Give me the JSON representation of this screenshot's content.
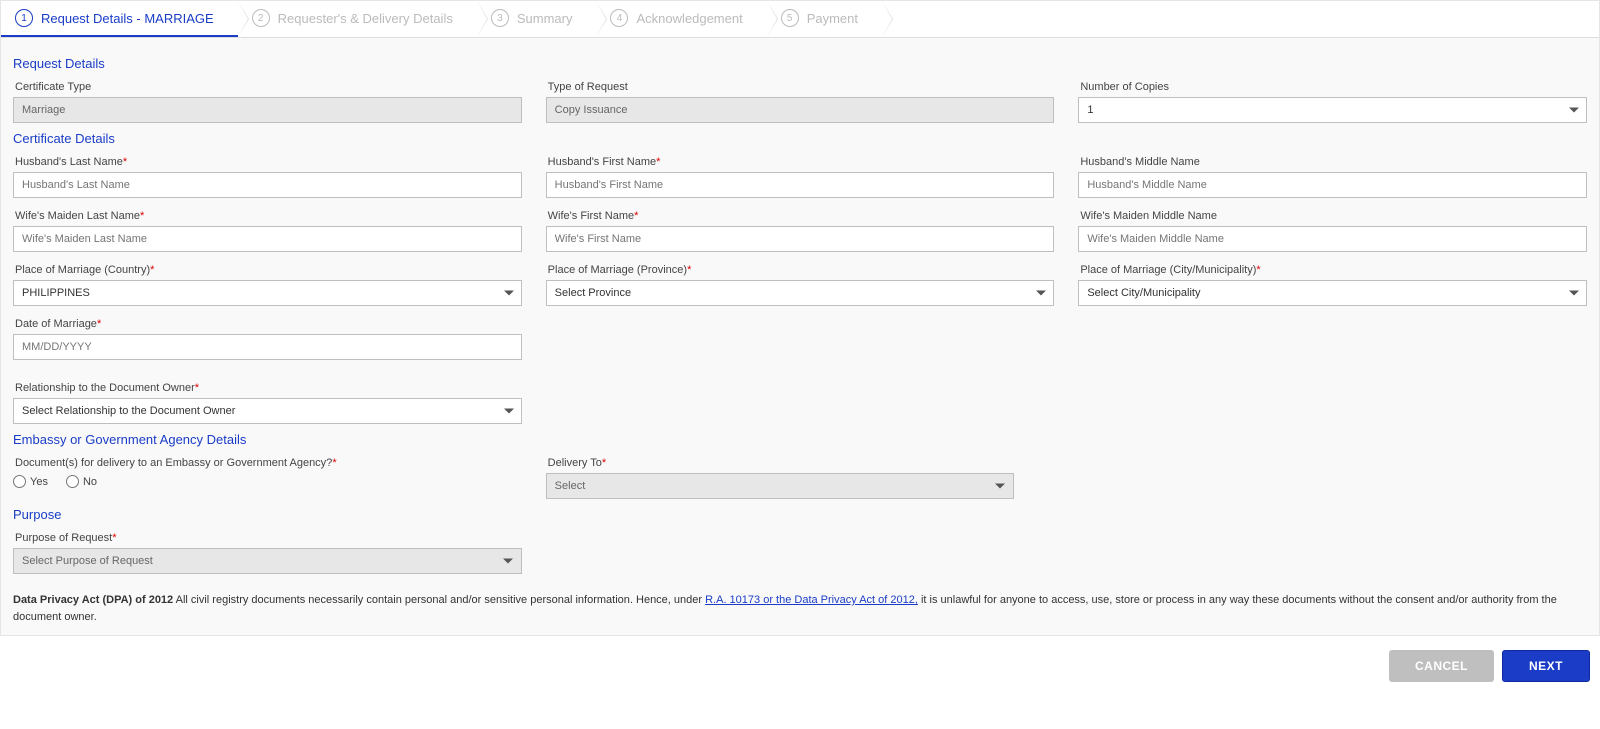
{
  "stepper": {
    "steps": [
      {
        "num": "1",
        "label": "Request Details - MARRIAGE",
        "active": true
      },
      {
        "num": "2",
        "label": "Requester's & Delivery Details",
        "active": false
      },
      {
        "num": "3",
        "label": "Summary",
        "active": false
      },
      {
        "num": "4",
        "label": "Acknowledgement",
        "active": false
      },
      {
        "num": "5",
        "label": "Payment",
        "active": false
      }
    ]
  },
  "sections": {
    "request_details": "Request Details",
    "certificate_details": "Certificate Details",
    "embassy": "Embassy or Government Agency Details",
    "purpose": "Purpose"
  },
  "labels": {
    "cert_type": "Certificate Type",
    "type_of_request": "Type of Request",
    "num_copies": "Number of Copies",
    "husband_last": "Husband's Last Name",
    "husband_first": "Husband's First Name",
    "husband_middle": "Husband's Middle Name",
    "wife_last": "Wife's Maiden Last Name",
    "wife_first": "Wife's First Name",
    "wife_middle": "Wife's Maiden Middle Name",
    "place_country": "Place of Marriage (Country)",
    "place_province": "Place of Marriage (Province)",
    "place_city": "Place of Marriage (City/Municipality)",
    "date_marriage": "Date of Marriage",
    "relationship": "Relationship to the Document Owner",
    "embassy_q": "Document(s) for delivery to an Embassy or Government Agency?",
    "delivery_to": "Delivery To",
    "purpose_req": "Purpose of Request"
  },
  "placeholders": {
    "husband_last": "Husband's Last Name",
    "husband_first": "Husband's First Name",
    "husband_middle": "Husband's Middle Name",
    "wife_last": "Wife's Maiden Last Name",
    "wife_first": "Wife's First Name",
    "wife_middle": "Wife's Maiden Middle Name",
    "date_marriage": "MM/DD/YYYY",
    "province_ph": "Select Province",
    "city_ph": "Select City/Municipality",
    "relationship_ph": "Select Relationship to the Document Owner",
    "delivery_to_ph": "Select",
    "purpose_ph": "Select Purpose of Request"
  },
  "values": {
    "cert_type": "Marriage",
    "type_of_request": "Copy Issuance",
    "num_copies": "1",
    "country": "PHILIPPINES"
  },
  "radio": {
    "yes": "Yes",
    "no": "No"
  },
  "privacy": {
    "bold": "Data Privacy Act (DPA) of 2012",
    "pre": " All civil registry documents necessarily contain personal and/or sensitive personal information. Hence, under ",
    "link": "R.A. 10173 or the Data Privacy Act of 2012,",
    "post": " it is unlawful for anyone to access, use, store or process in any way these documents without the consent and/or authority from the document owner."
  },
  "buttons": {
    "cancel": "CANCEL",
    "next": "NEXT"
  }
}
